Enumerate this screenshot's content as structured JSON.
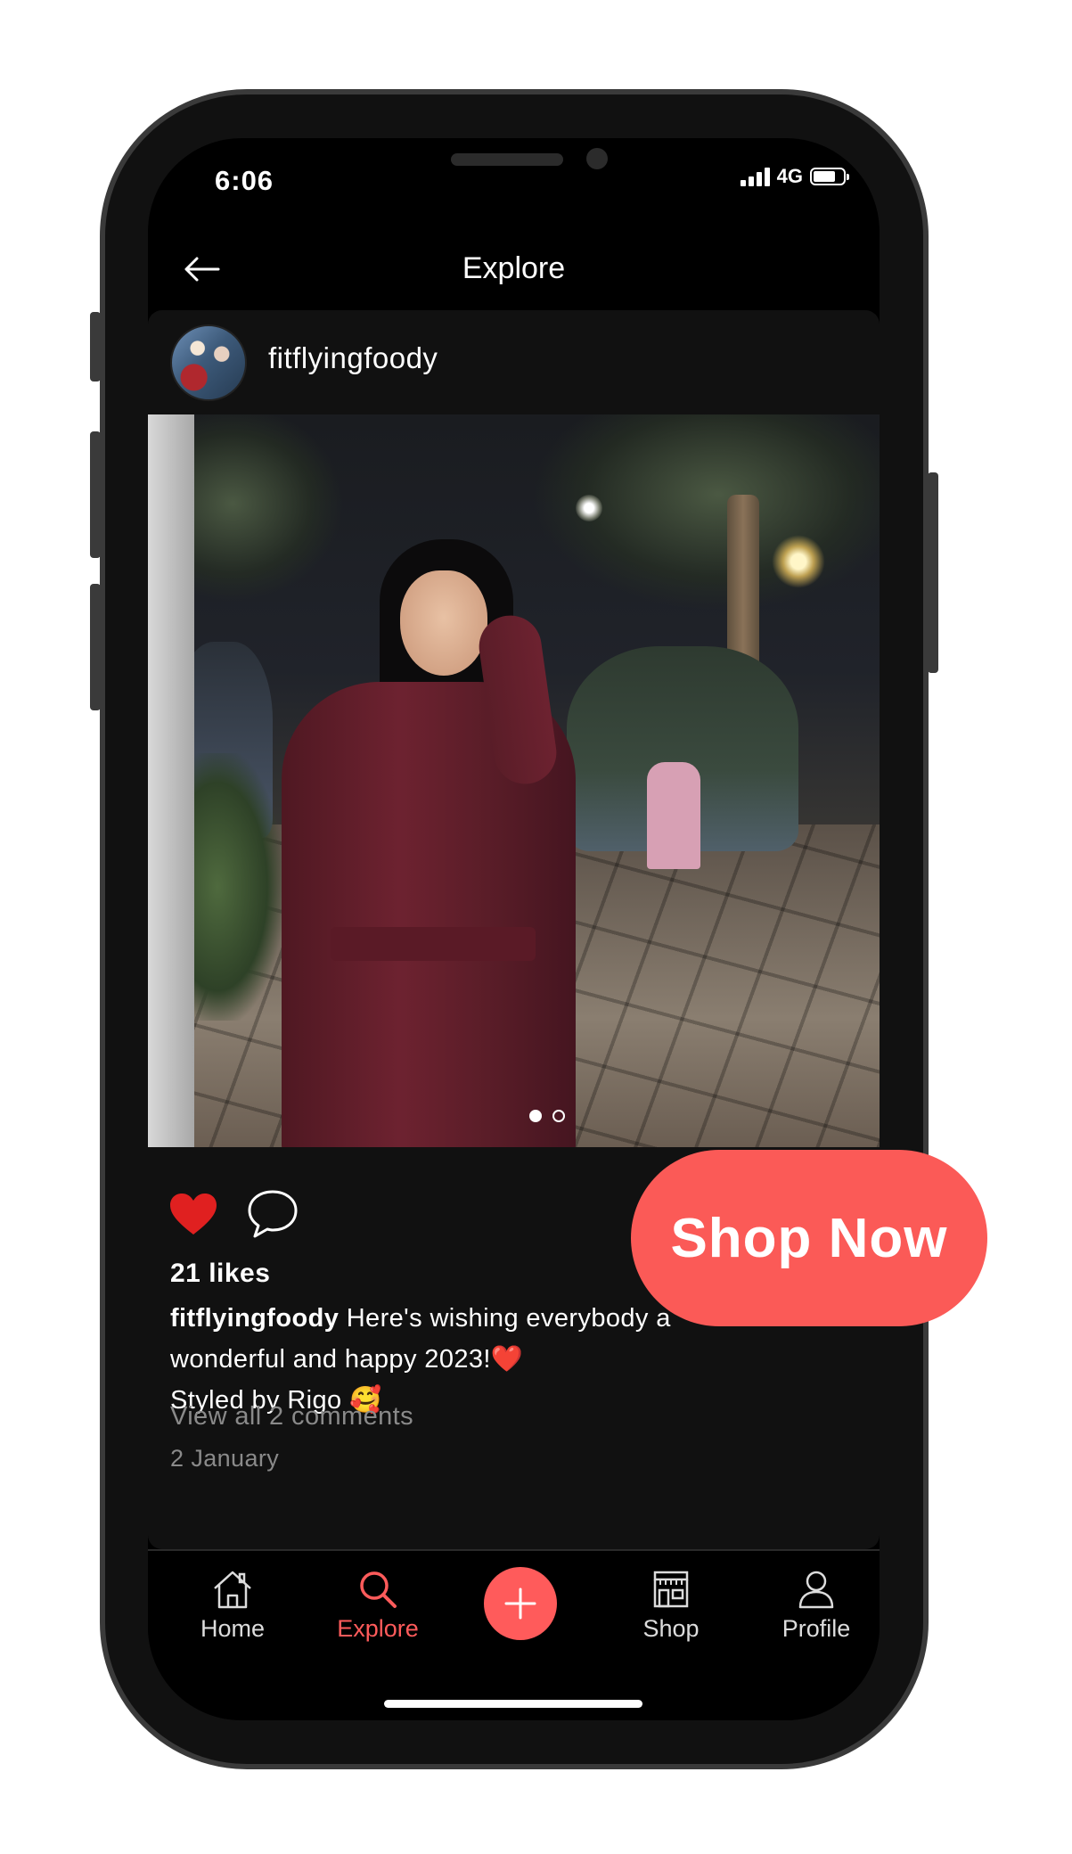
{
  "status_bar": {
    "time": "6:06",
    "network": "4G"
  },
  "header": {
    "title": "Explore",
    "back_icon": "arrow-left-icon"
  },
  "post": {
    "username": "fitflyingfoody",
    "carousel": {
      "count": 2,
      "active_index": 0
    },
    "liked": true,
    "likes_text": "21 likes",
    "caption_user": "fitflyingfoody",
    "caption_line1": "Here's wishing everybody a",
    "caption_line2": "wonderful and happy 2023!❤️",
    "caption_line3": "Styled by Rigo 🥰",
    "view_comments": "View all 2 comments",
    "date": "2 January"
  },
  "tabs": [
    {
      "label": "Home",
      "icon": "home-icon",
      "active": false
    },
    {
      "label": "Explore",
      "icon": "search-icon",
      "active": true
    },
    {
      "label": "",
      "icon": "plus-icon",
      "active": false
    },
    {
      "label": "Shop",
      "icon": "store-icon",
      "active": false
    },
    {
      "label": "Profile",
      "icon": "user-icon",
      "active": false
    }
  ],
  "cta": {
    "label": "Shop Now"
  },
  "colors": {
    "accent": "#ff5b5b",
    "cta": "#fb5a57",
    "like": "#e02020",
    "background": "#000000",
    "card": "#111111"
  }
}
